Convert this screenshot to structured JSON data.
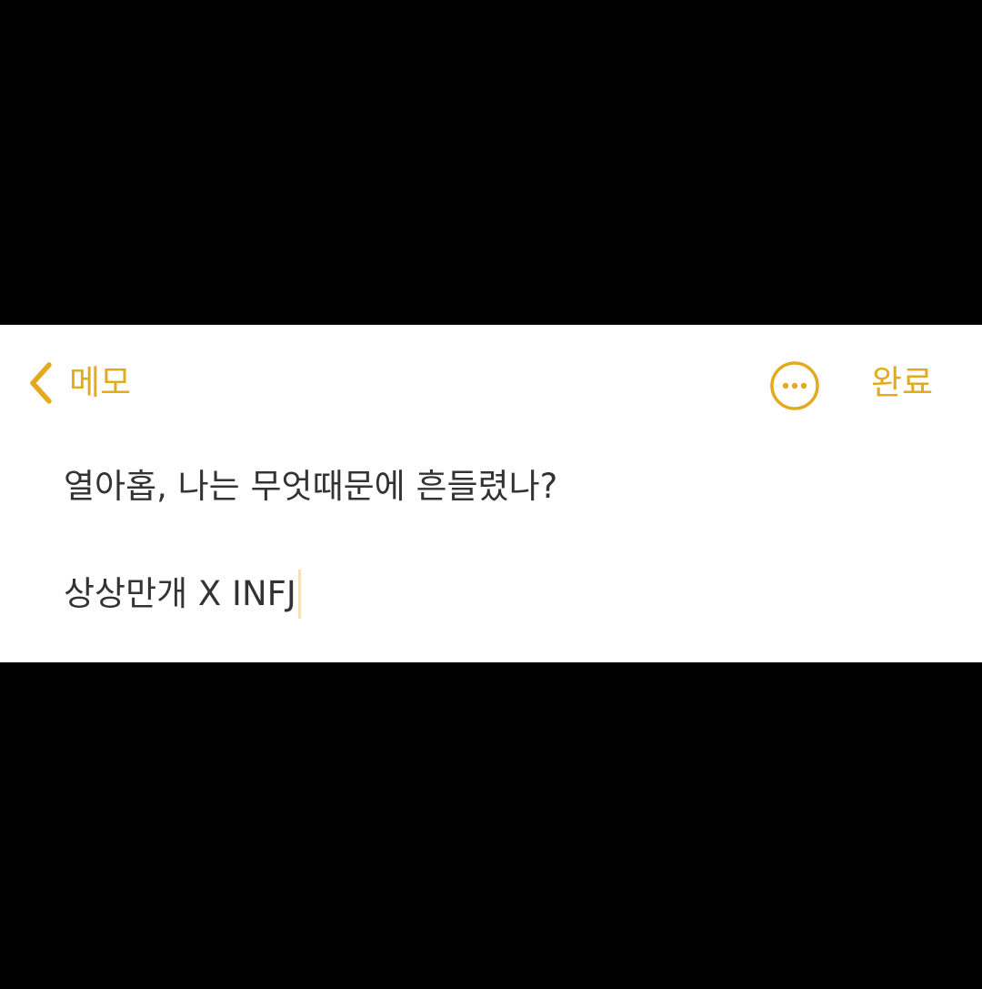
{
  "colors": {
    "accent": "#e3aa1e",
    "background": "#ffffff",
    "letterbox": "#000000",
    "text": "#333333",
    "caret": "#f3e2b3"
  },
  "nav": {
    "back_icon": "chevron-left-icon",
    "back_label": "메모",
    "more_icon": "ellipsis-circle-icon",
    "done_label": "완료"
  },
  "note": {
    "lines": [
      "열아홉, 나는 무엇때문에 흔들렸나?",
      "상상만개 X INFJ"
    ]
  }
}
